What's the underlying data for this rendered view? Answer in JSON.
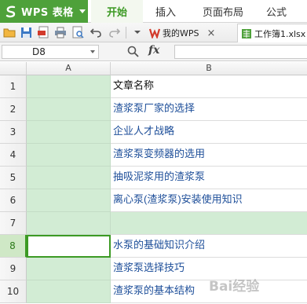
{
  "app": {
    "name": "WPS 表格"
  },
  "ribbon_tabs": [
    "开始",
    "插入",
    "页面布局",
    "公式"
  ],
  "doc_tabs": [
    {
      "label": "我的WPS",
      "close": "×"
    },
    {
      "label": "工作簿1.xlsx"
    }
  ],
  "formula_bar": {
    "cell_ref": "D8",
    "fx_label": "fx",
    "value": ""
  },
  "columns": [
    "A",
    "B"
  ],
  "rows": [
    {
      "num": "1",
      "b": "文章名称"
    },
    {
      "num": "2",
      "b": "渣浆泵厂家的选择"
    },
    {
      "num": "3",
      "b": "企业人才战略"
    },
    {
      "num": "4",
      "b": "渣浆泵变频器的选用"
    },
    {
      "num": "5",
      "b": "抽吸泥浆用的渣浆泵"
    },
    {
      "num": "6",
      "b": "离心泵(渣浆泵)安装使用知识"
    },
    {
      "num": "7",
      "b": ""
    },
    {
      "num": "8",
      "b": "水泵的基础知识介绍"
    },
    {
      "num": "9",
      "b": "渣浆泵选择技巧"
    },
    {
      "num": "10",
      "b": "渣浆泵的基本结构"
    }
  ],
  "colors": {
    "accent": "#3c9a24",
    "app_bg": "#4ea13a",
    "selection_fill": "#d2ecd4",
    "link": "#1d4e99"
  },
  "watermark": "Bai经验"
}
